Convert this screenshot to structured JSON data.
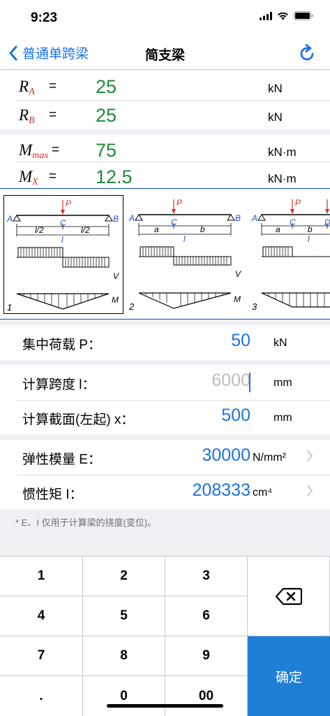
{
  "status": {
    "time": "9:23"
  },
  "nav": {
    "back_label": "普通单跨梁",
    "title": "简支梁"
  },
  "results": [
    {
      "sym": "R",
      "sub": "A",
      "eq": "=",
      "value": "25",
      "unit": "kN"
    },
    {
      "sym": "R",
      "sub": "B",
      "eq": "=",
      "value": "25",
      "unit": "kN"
    },
    {
      "sym": "M",
      "sub": "max",
      "eq": "=",
      "value": "75",
      "unit": "kN·m"
    },
    {
      "sym": "M",
      "sub": "X",
      "eq": "=",
      "value": "12.5",
      "unit": "kN·m"
    }
  ],
  "diagrams": [
    {
      "number": "1",
      "load": "P",
      "left": "A",
      "mid": "C",
      "right": "B",
      "dim1": "l/2",
      "dim2": "l/2",
      "total": "l",
      "shear": "V",
      "moment": "M"
    },
    {
      "number": "2",
      "load": "P",
      "left": "A",
      "mid": "C",
      "right": "B",
      "dim1": "a",
      "dim2": "b",
      "total": "l",
      "shear": "V",
      "moment": "M"
    },
    {
      "number": "3",
      "load": "P",
      "left": "A",
      "mid": "C",
      "right": "D",
      "dim1": "a",
      "dim2": "b",
      "total": "l"
    }
  ],
  "inputs": {
    "load": {
      "label": "集中荷载  P：",
      "value": "50",
      "unit": "kN"
    },
    "span": {
      "label": "计算跨度  l：",
      "value": "6000",
      "unit": "mm"
    },
    "section": {
      "label": "计算截面(左起)  x：",
      "value": "500",
      "unit": "mm"
    },
    "modulus": {
      "label": "弹性模量  E：",
      "value": "30000",
      "unit": "N/mm²"
    },
    "inertia": {
      "label": "惯性矩  I：",
      "value": "208333",
      "unit": "cm⁴"
    }
  },
  "footnote": "* E、I 仅用于计算梁的挠度(变位)。",
  "keyboard": {
    "keys": [
      "1",
      "2",
      "3",
      "4",
      "5",
      "6",
      "7",
      "8",
      "9",
      ".",
      "0",
      "00"
    ],
    "confirm": "确定"
  },
  "colors": {
    "accent": "#1a73e8",
    "result_green": "#1e8a3a",
    "subscript_red": "#d93025",
    "confirm_bg": "#1f7fd6"
  }
}
